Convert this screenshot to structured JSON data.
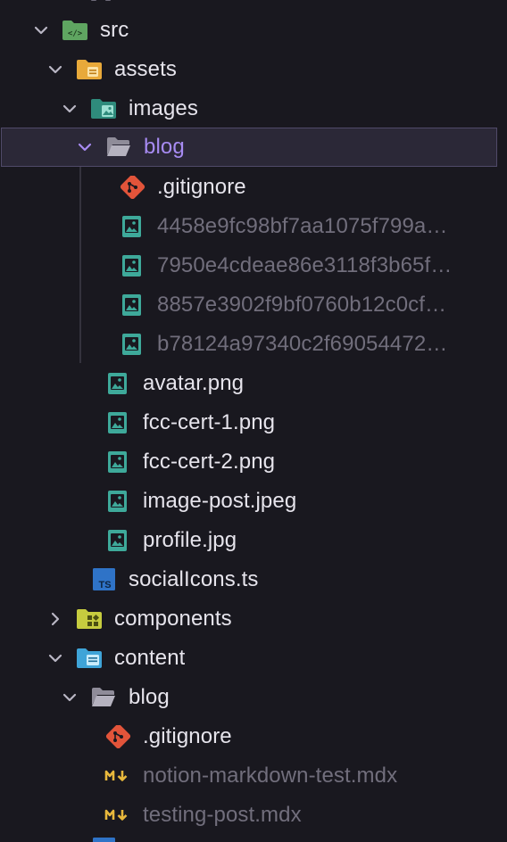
{
  "explorer": {
    "items": {
      "src": {
        "label": "src",
        "icon": "folder-source-icon",
        "state": "expanded"
      },
      "assets": {
        "label": "assets",
        "icon": "folder-assets-icon",
        "state": "expanded"
      },
      "images": {
        "label": "images",
        "icon": "folder-images-icon",
        "state": "expanded"
      },
      "blog": {
        "label": "blog",
        "icon": "folder-open-icon",
        "state": "expanded",
        "selected": true
      },
      "gitignore1": {
        "label": ".gitignore",
        "icon": "git-icon"
      },
      "img1": {
        "label": "4458e9fc98bf7aa1075f799a…",
        "icon": "image-file-icon",
        "dimmed": true
      },
      "img2": {
        "label": "7950e4cdeae86e3118f3b65f…",
        "icon": "image-file-icon",
        "dimmed": true
      },
      "img3": {
        "label": "8857e3902f9bf0760b12c0cf…",
        "icon": "image-file-icon",
        "dimmed": true
      },
      "img4": {
        "label": "b78124a97340c2f69054472…",
        "icon": "image-file-icon",
        "dimmed": true
      },
      "avatar": {
        "label": "avatar.png",
        "icon": "image-file-icon"
      },
      "fcc1": {
        "label": "fcc-cert-1.png",
        "icon": "image-file-icon"
      },
      "fcc2": {
        "label": "fcc-cert-2.png",
        "icon": "image-file-icon"
      },
      "imagepost": {
        "label": "image-post.jpeg",
        "icon": "image-file-icon"
      },
      "profile": {
        "label": "profile.jpg",
        "icon": "image-file-icon"
      },
      "socialicons": {
        "label": "socialIcons.ts",
        "icon": "typescript-file-icon"
      },
      "components": {
        "label": "components",
        "icon": "folder-components-icon",
        "state": "collapsed"
      },
      "content": {
        "label": "content",
        "icon": "folder-content-icon",
        "state": "expanded"
      },
      "cblog": {
        "label": "blog",
        "icon": "folder-open-icon",
        "state": "expanded"
      },
      "gitignore2": {
        "label": ".gitignore",
        "icon": "git-icon"
      },
      "notion": {
        "label": "notion-markdown-test.mdx",
        "icon": "mdx-file-icon",
        "dimmed": true
      },
      "testing": {
        "label": "testing-post.mdx",
        "icon": "mdx-file-icon",
        "dimmed": true
      }
    }
  },
  "colors": {
    "background": "#19181f",
    "selection_background": "#2b2837",
    "selection_border": "#504a69",
    "selected_text": "#a78bf2",
    "text": "#e6e4ec",
    "dimmed_text": "#716e7c",
    "image_icon": "#3ea99a",
    "git_icon": "#e2543a",
    "typescript_icon": "#2f73c7",
    "mdx_icon": "#e8b83c"
  }
}
